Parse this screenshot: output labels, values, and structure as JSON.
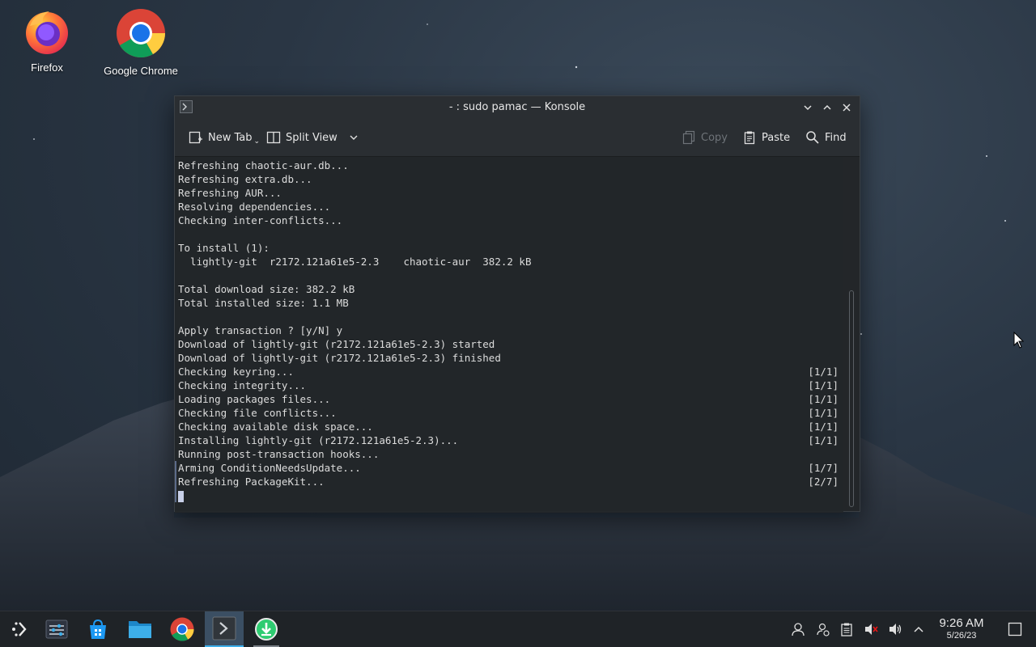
{
  "desktop": {
    "icons": [
      {
        "label": "Firefox",
        "icon": "firefox-icon"
      },
      {
        "label": "Google Chrome",
        "icon": "chrome-icon"
      }
    ]
  },
  "window": {
    "title": "- : sudo pamac — Konsole",
    "toolbar": {
      "new_tab": "New Tab",
      "split_view": "Split View",
      "copy": "Copy",
      "paste": "Paste",
      "find": "Find"
    },
    "terminal_lines": [
      {
        "text": "Refreshing chaotic-aur.db...",
        "right": ""
      },
      {
        "text": "Refreshing extra.db...",
        "right": ""
      },
      {
        "text": "Refreshing AUR...",
        "right": ""
      },
      {
        "text": "Resolving dependencies...",
        "right": ""
      },
      {
        "text": "Checking inter-conflicts...",
        "right": ""
      },
      {
        "text": "",
        "right": ""
      },
      {
        "text": "To install (1):",
        "right": ""
      },
      {
        "text": "  lightly-git  r2172.121a61e5-2.3    chaotic-aur  382.2 kB",
        "right": ""
      },
      {
        "text": "",
        "right": ""
      },
      {
        "text": "Total download size: 382.2 kB",
        "right": ""
      },
      {
        "text": "Total installed size: 1.1 MB",
        "right": ""
      },
      {
        "text": "",
        "right": ""
      },
      {
        "text": "Apply transaction ? [y/N] y",
        "right": ""
      },
      {
        "text": "Download of lightly-git (r2172.121a61e5-2.3) started",
        "right": ""
      },
      {
        "text": "Download of lightly-git (r2172.121a61e5-2.3) finished",
        "right": ""
      },
      {
        "text": "Checking keyring...",
        "right": "[1/1]"
      },
      {
        "text": "Checking integrity...",
        "right": "[1/1]"
      },
      {
        "text": "Loading packages files...",
        "right": "[1/1]"
      },
      {
        "text": "Checking file conflicts...",
        "right": "[1/1]"
      },
      {
        "text": "Checking available disk space...",
        "right": "[1/1]"
      },
      {
        "text": "Installing lightly-git (r2172.121a61e5-2.3)...",
        "right": "[1/1]"
      },
      {
        "text": "Running post-transaction hooks...",
        "right": ""
      },
      {
        "text": "Arming ConditionNeedsUpdate...",
        "right": "[1/7]",
        "marked": true
      },
      {
        "text": "Refreshing PackageKit...",
        "right": "[2/7]",
        "marked": true
      }
    ]
  },
  "taskbar": {
    "apps": [
      {
        "name": "app-launcher",
        "icon": "kde-launcher-icon"
      },
      {
        "name": "system-settings",
        "icon": "settings-icon"
      },
      {
        "name": "discover",
        "icon": "store-bag-icon"
      },
      {
        "name": "file-manager",
        "icon": "folder-icon"
      },
      {
        "name": "google-chrome",
        "icon": "chrome-icon"
      },
      {
        "name": "konsole",
        "icon": "terminal-icon",
        "active": true
      },
      {
        "name": "pamac",
        "icon": "download-icon",
        "running": true
      }
    ],
    "tray": [
      "user-icon",
      "user-switch-icon",
      "clipboard-icon",
      "volume-muted-icon",
      "volume-icon",
      "tray-expand-icon"
    ],
    "clock": {
      "time": "9:26 AM",
      "date": "5/26/23"
    },
    "show_desktop": "show-desktop-icon"
  },
  "colors": {
    "accent": "#3daee9",
    "window_bg": "#232629",
    "taskbar_bg": "#1f2327",
    "terminal_fg": "#dcdcdc"
  }
}
